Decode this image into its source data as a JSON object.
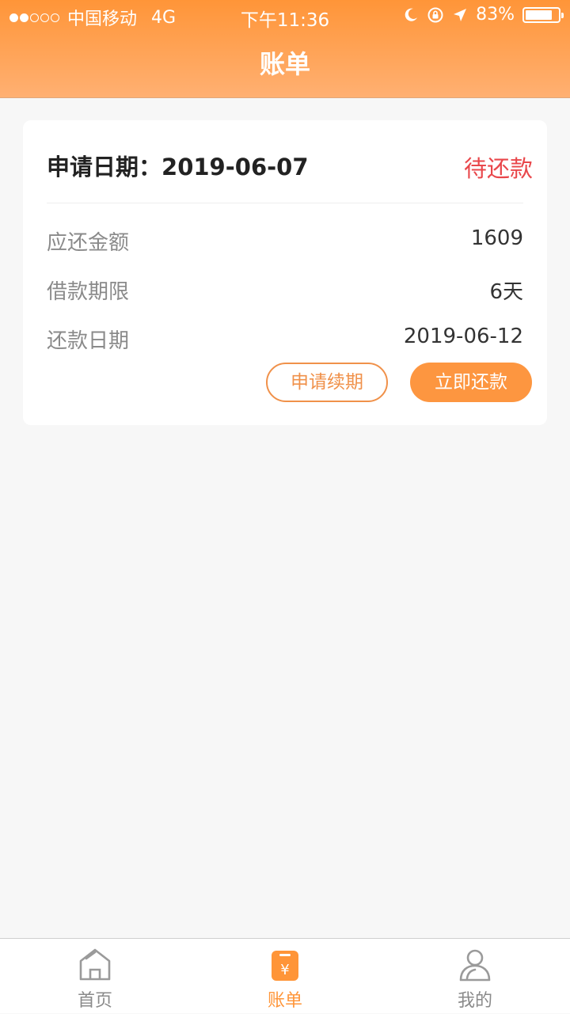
{
  "status_bar": {
    "carrier": "中国移动",
    "network": "4G",
    "time": "下午11:36",
    "battery": "83%",
    "battery_level": 0.83,
    "signal_dots_filled": 2,
    "signal_dots_total": 5
  },
  "header": {
    "title": "账单"
  },
  "bill": {
    "apply_label": "申请日期：",
    "apply_date": "2019-06-07",
    "status": "待还款",
    "rows": [
      {
        "label": "应还金额",
        "value": "1609"
      },
      {
        "label": "借款期限",
        "value": "6天"
      },
      {
        "label": "还款日期",
        "value": "2019-06-12"
      }
    ],
    "renew_button": "申请续期",
    "pay_button": "立即还款"
  },
  "tabbar": {
    "items": [
      {
        "label": "首页",
        "icon": "home-icon",
        "active": false
      },
      {
        "label": "账单",
        "icon": "bill-icon",
        "active": true
      },
      {
        "label": "我的",
        "icon": "user-icon",
        "active": false
      }
    ]
  },
  "colors": {
    "accent": "#ff9538",
    "status_red": "#e9474b",
    "label_gray": "#8a8a8a"
  }
}
